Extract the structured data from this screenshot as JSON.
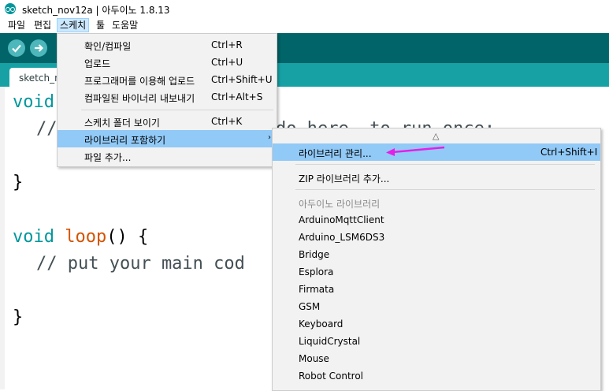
{
  "window": {
    "title": "sketch_nov12a | 아두이노 1.8.13"
  },
  "menubar": {
    "items": [
      "파일",
      "편집",
      "스케치",
      "툴",
      "도움말"
    ],
    "active_index": 2
  },
  "toolbar": {
    "buttons": [
      "verify-icon",
      "upload-icon"
    ]
  },
  "tabs": [
    {
      "label": "sketch_n"
    }
  ],
  "editor": {
    "lines": [
      {
        "kw": "void",
        "fn": "",
        "rest": ""
      },
      {
        "comment": "//"
      },
      {
        "text": "}"
      },
      {
        "kw": "void",
        "fn": "loop",
        "rest": "() {"
      },
      {
        "comment": "// put your main cod"
      },
      {
        "text": "}"
      }
    ],
    "behind_text": "do here, to run once:"
  },
  "sketch_menu": {
    "items": [
      {
        "label": "확인/컴파일",
        "shortcut": "Ctrl+R"
      },
      {
        "label": "업로드",
        "shortcut": "Ctrl+U"
      },
      {
        "label": "프로그래머를 이용해 업로드",
        "shortcut": "Ctrl+Shift+U"
      },
      {
        "label": "컴파일된 바이너리 내보내기",
        "shortcut": "Ctrl+Alt+S"
      },
      {
        "label": "스케치 폴더 보이기",
        "shortcut": "Ctrl+K"
      },
      {
        "label": "라이브러리 포함하기",
        "shortcut": "",
        "submenu_arrow": "›"
      },
      {
        "label": "파일 추가...",
        "shortcut": ""
      }
    ]
  },
  "library_submenu": {
    "scroll_up_glyph": "△",
    "manage": {
      "label": "라이브러리 관리...",
      "shortcut": "Ctrl+Shift+I"
    },
    "add_zip": "ZIP 라이브러리 추가...",
    "section_header": "아두이노 라이브러리",
    "libraries": [
      "ArduinoMqttClient",
      "Arduino_LSM6DS3",
      "Bridge",
      "Esplora",
      "Firmata",
      "GSM",
      "Keyboard",
      "LiquidCrystal",
      "Mouse",
      "Robot Control"
    ]
  },
  "colors": {
    "toolbar_bg": "#006468",
    "tabstrip_bg": "#17a1a5",
    "menu_highlight": "#91c9f7",
    "annotation_arrow": "#e61ee6"
  }
}
